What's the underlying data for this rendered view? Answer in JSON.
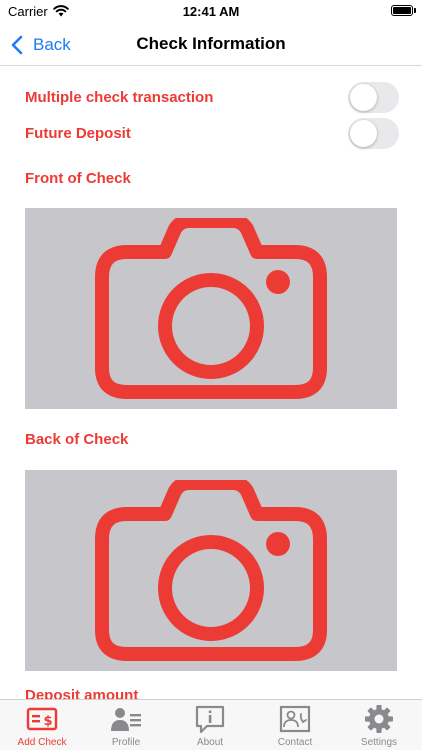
{
  "status_bar": {
    "carrier": "Carrier",
    "time": "12:41 AM"
  },
  "nav": {
    "back_label": "Back",
    "title": "Check Information"
  },
  "form": {
    "multiple_check_label": "Multiple check transaction",
    "multiple_check_on": false,
    "future_deposit_label": "Future Deposit",
    "future_deposit_on": false,
    "front_label": "Front of Check",
    "back_label": "Back of Check",
    "deposit_amount_label": "Deposit amount"
  },
  "tabs": [
    {
      "label": "Add Check",
      "icon": "check-dollar-icon",
      "active": true
    },
    {
      "label": "Profile",
      "icon": "profile-card-icon",
      "active": false
    },
    {
      "label": "About",
      "icon": "info-bubble-icon",
      "active": false
    },
    {
      "label": "Contact",
      "icon": "contact-card-icon",
      "active": false
    },
    {
      "label": "Settings",
      "icon": "gear-icon",
      "active": false
    }
  ],
  "colors": {
    "accent_red": "#ec3b35",
    "link_blue": "#1e7cf5",
    "photo_placeholder": "#c6c6cb",
    "tab_inactive": "#8a8a8e"
  }
}
